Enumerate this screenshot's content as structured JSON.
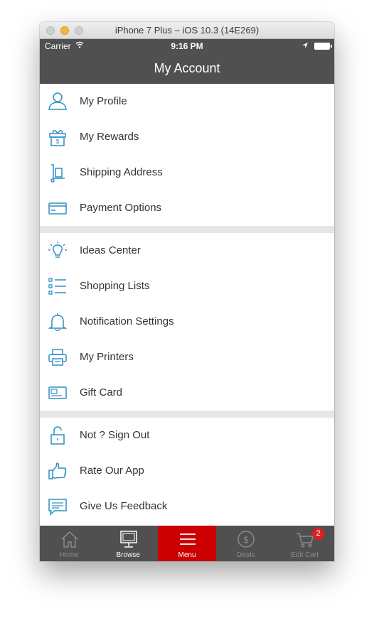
{
  "window": {
    "title": "iPhone 7 Plus – iOS 10.3 (14E269)"
  },
  "status_bar": {
    "carrier": "Carrier",
    "time": "9:16 PM"
  },
  "nav": {
    "title": "My Account"
  },
  "menu_groups": [
    {
      "items": [
        {
          "label": "My Profile",
          "icon": "person-icon"
        },
        {
          "label": "My Rewards",
          "icon": "gift-icon"
        },
        {
          "label": "Shipping Address",
          "icon": "hand-truck-icon"
        },
        {
          "label": "Payment Options",
          "icon": "credit-card-icon"
        }
      ]
    },
    {
      "items": [
        {
          "label": "Ideas Center",
          "icon": "lightbulb-icon"
        },
        {
          "label": "Shopping Lists",
          "icon": "list-icon"
        },
        {
          "label": "Notification Settings",
          "icon": "bell-icon"
        },
        {
          "label": "My Printers",
          "icon": "printer-icon"
        },
        {
          "label": "Gift Card",
          "icon": "gift-card-icon"
        }
      ]
    },
    {
      "items": [
        {
          "label": "Not ? Sign Out",
          "icon": "unlock-icon"
        },
        {
          "label": "Rate Our App",
          "icon": "thumbs-up-icon"
        },
        {
          "label": "Give Us Feedback",
          "icon": "speech-bubble-icon"
        }
      ]
    }
  ],
  "tab_bar": {
    "tabs": [
      {
        "label": "Home",
        "icon": "home-icon"
      },
      {
        "label": "Browse",
        "icon": "monitor-icon"
      },
      {
        "label": "Menu",
        "icon": "menu-icon",
        "active": true
      },
      {
        "label": "Deals",
        "icon": "dollar-circle-icon"
      },
      {
        "label": "Edit Cart",
        "icon": "cart-icon",
        "badge": "2"
      }
    ]
  },
  "colors": {
    "header_bg": "#505050",
    "icon_blue": "#2d8fc4",
    "active_tab": "#cc0000",
    "badge": "#e02020",
    "separator": "#e6e6e6"
  }
}
